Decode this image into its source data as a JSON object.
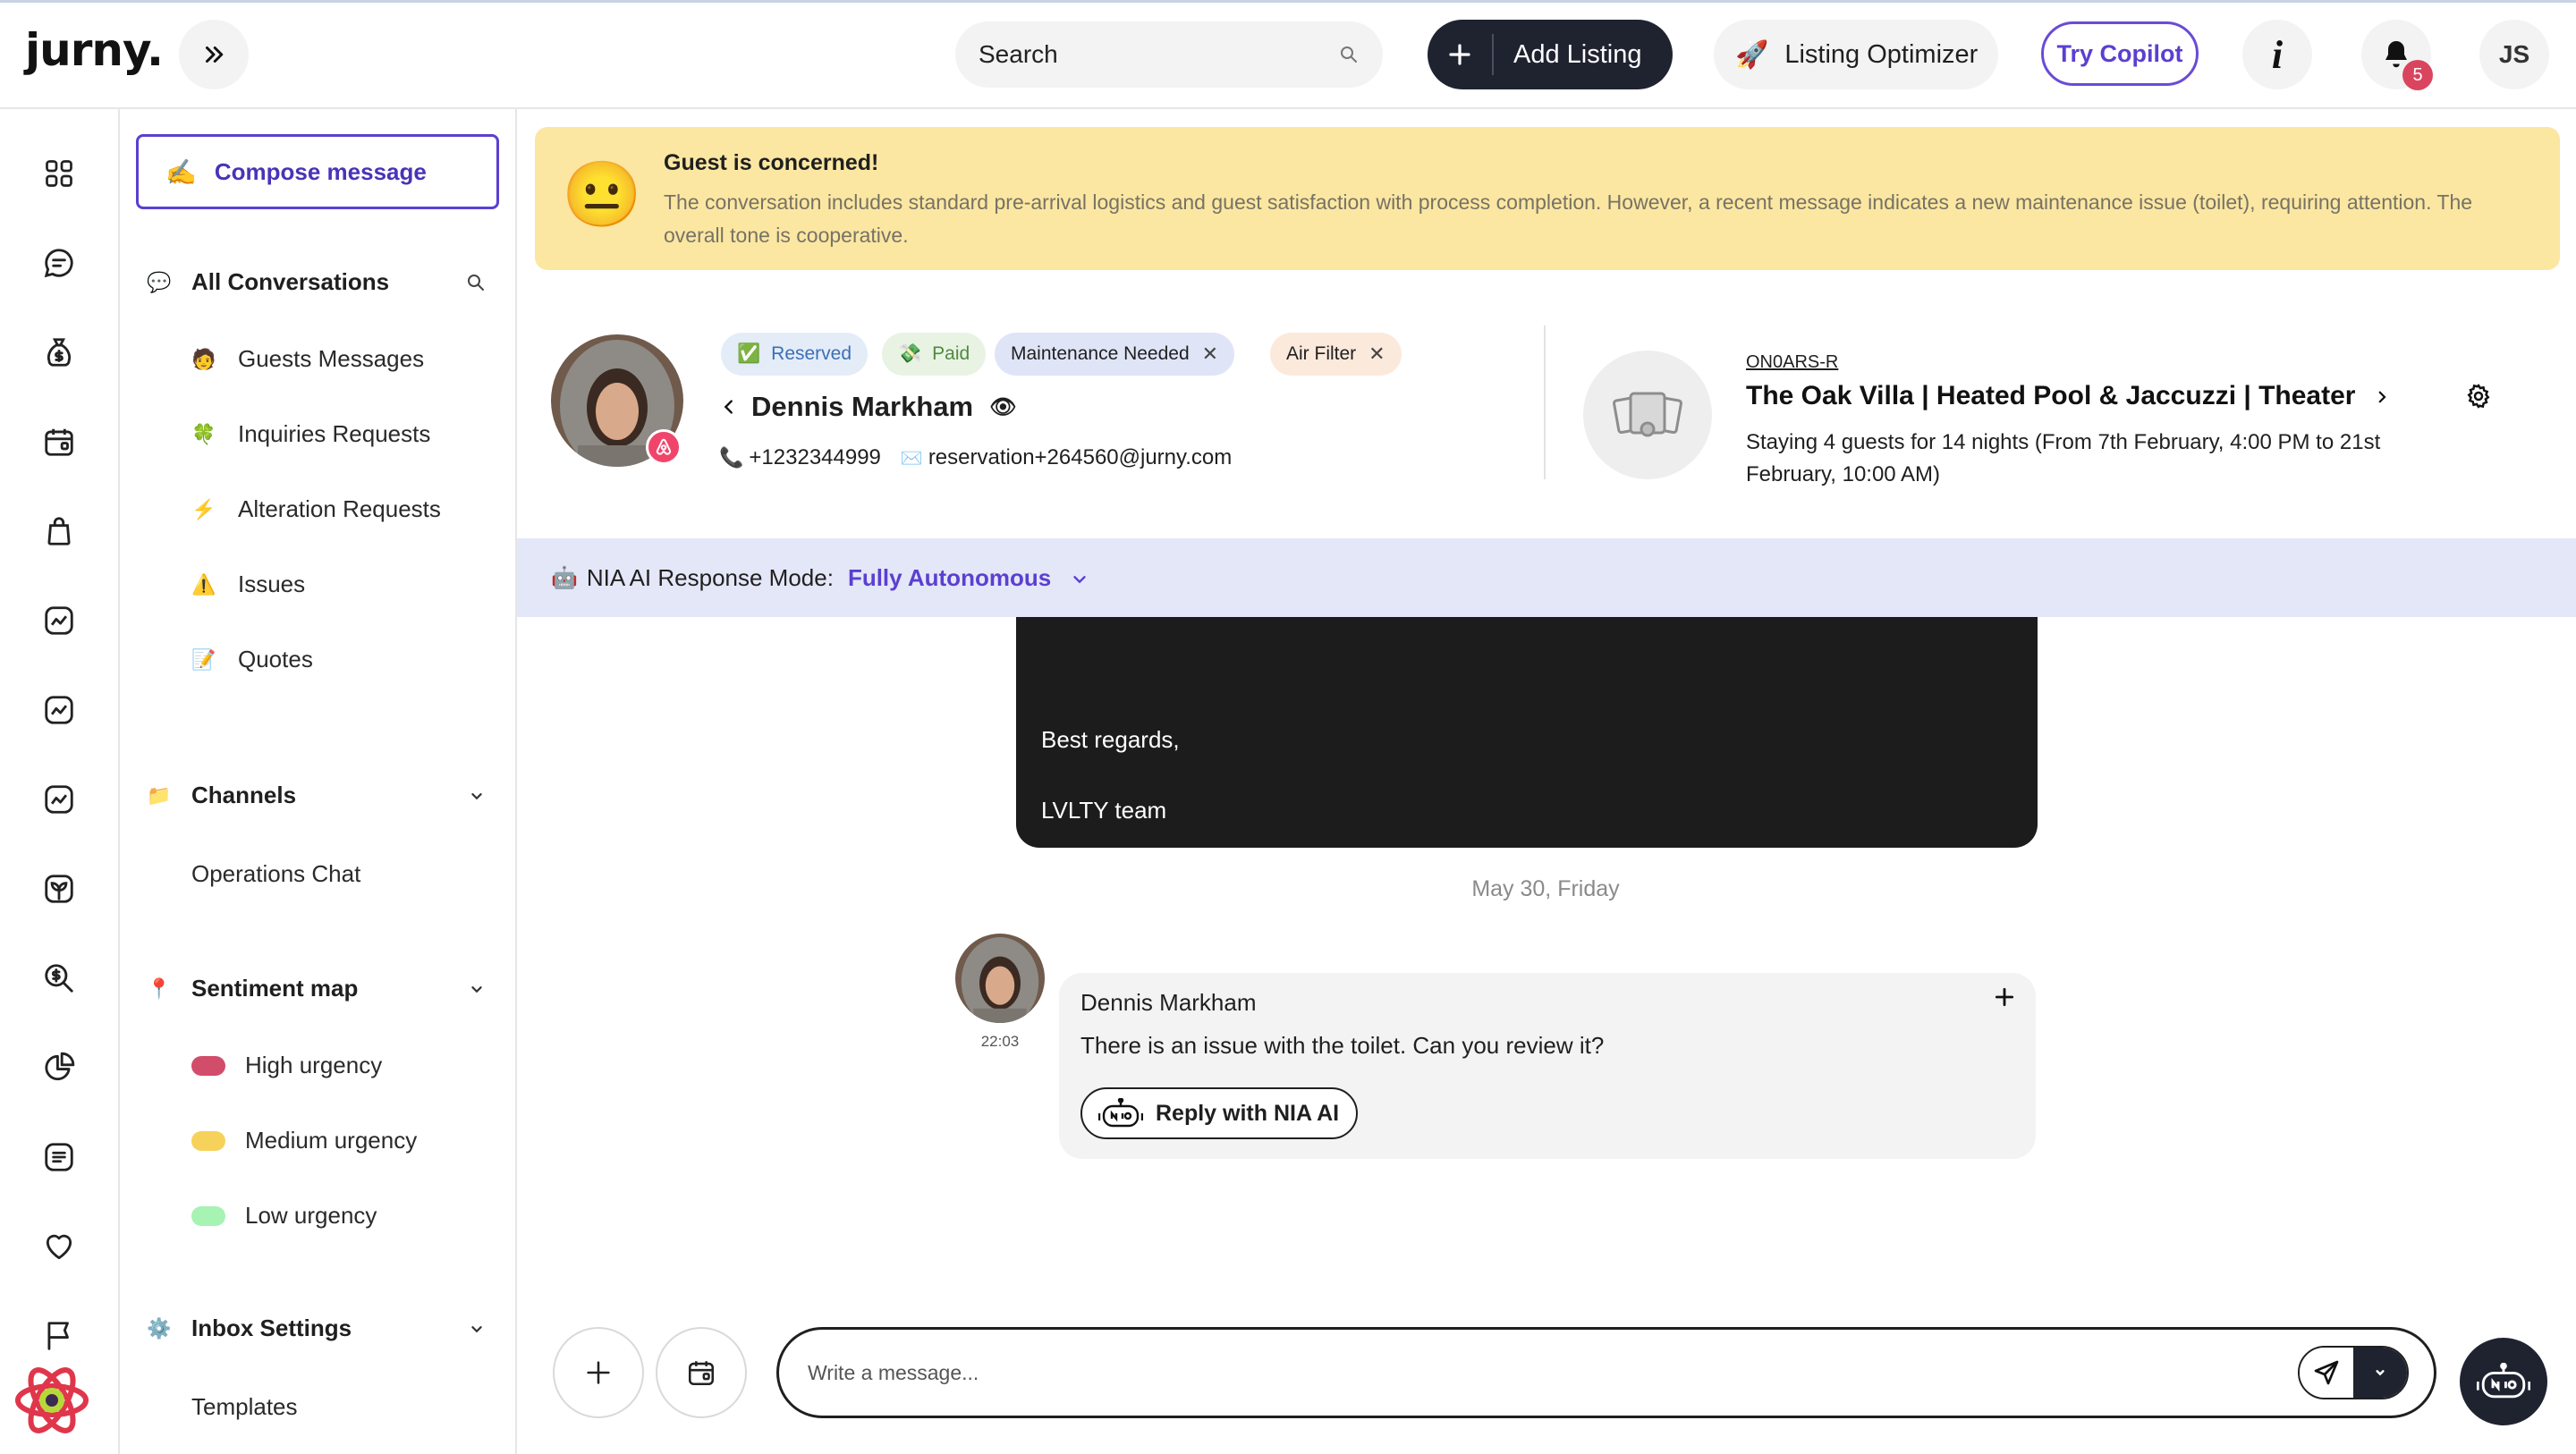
{
  "header": {
    "logo": "jurny.",
    "search_placeholder": "Search",
    "add_listing_label": "Add Listing",
    "listing_optimizer_label": "Listing Optimizer",
    "try_copilot_label": "Try Copilot",
    "notifications_count": "5",
    "user_initials": "JS"
  },
  "nav": {
    "compose_label": "Compose message",
    "all_conversations": "All Conversations",
    "items": [
      {
        "label": "Guests Messages",
        "icon": "🧑"
      },
      {
        "label": "Inquiries Requests",
        "icon": "🍀"
      },
      {
        "label": "Alteration Requests",
        "icon": "⚡"
      },
      {
        "label": "Issues",
        "icon": "⚠️"
      },
      {
        "label": "Quotes",
        "icon": "📝"
      }
    ],
    "channels_label": "Channels",
    "channels": [
      {
        "label": "Operations Chat"
      }
    ],
    "sentiment_label": "Sentiment map",
    "sentiment": [
      {
        "label": "High urgency",
        "color": "#d24d6a"
      },
      {
        "label": "Medium urgency",
        "color": "#f7d25a"
      },
      {
        "label": "Low urgency",
        "color": "#a6f3b3"
      }
    ],
    "inbox_settings_label": "Inbox Settings",
    "templates_label": "Templates"
  },
  "alert": {
    "emoji": "😐",
    "title": "Guest is concerned!",
    "body": "The conversation includes standard pre-arrival logistics and guest satisfaction with process completion. However, a recent message indicates a new maintenance issue (toilet), requiring attention. The overall tone is cooperative."
  },
  "guest": {
    "tags": [
      {
        "label": "Reserved",
        "icon": "✅",
        "bg": "#e4ecf8",
        "color": "#3b6fb5",
        "removable": false
      },
      {
        "label": "Paid",
        "icon": "💸",
        "bg": "#e8f3e4",
        "color": "#4f8a3e",
        "removable": false
      },
      {
        "label": "Maintenance Needed",
        "icon": "",
        "bg": "#dfe4f7",
        "color": "#1f1f1f",
        "removable": true
      },
      {
        "label": "Air Filter",
        "icon": "",
        "bg": "#fbe9dc",
        "color": "#1f1f1f",
        "removable": true
      }
    ],
    "name": "Dennis Markham",
    "phone": "+1232344999",
    "email": "reservation+264560@jurny.com"
  },
  "property": {
    "code": "ON0ARS-R",
    "name": "The Oak Villa | Heated Pool & Jaccuzzi | Theater",
    "stay": "Staying 4 guests for 14 nights (From 7th February, 4:00 PM to 21st February, 10:00 AM)"
  },
  "mode": {
    "label": "NIA AI Response Mode:",
    "value": "Fully Autonomous"
  },
  "messages": {
    "prev_line1": "Best regards,",
    "prev_line2": "LVLTY team",
    "date_separator": "May 30, Friday",
    "sender": "Dennis Markham",
    "time": "22:03",
    "text": "There is an issue with the toilet. Can you review it?",
    "reply_button": "Reply with NIA AI"
  },
  "composer": {
    "placeholder": "Write a message..."
  }
}
